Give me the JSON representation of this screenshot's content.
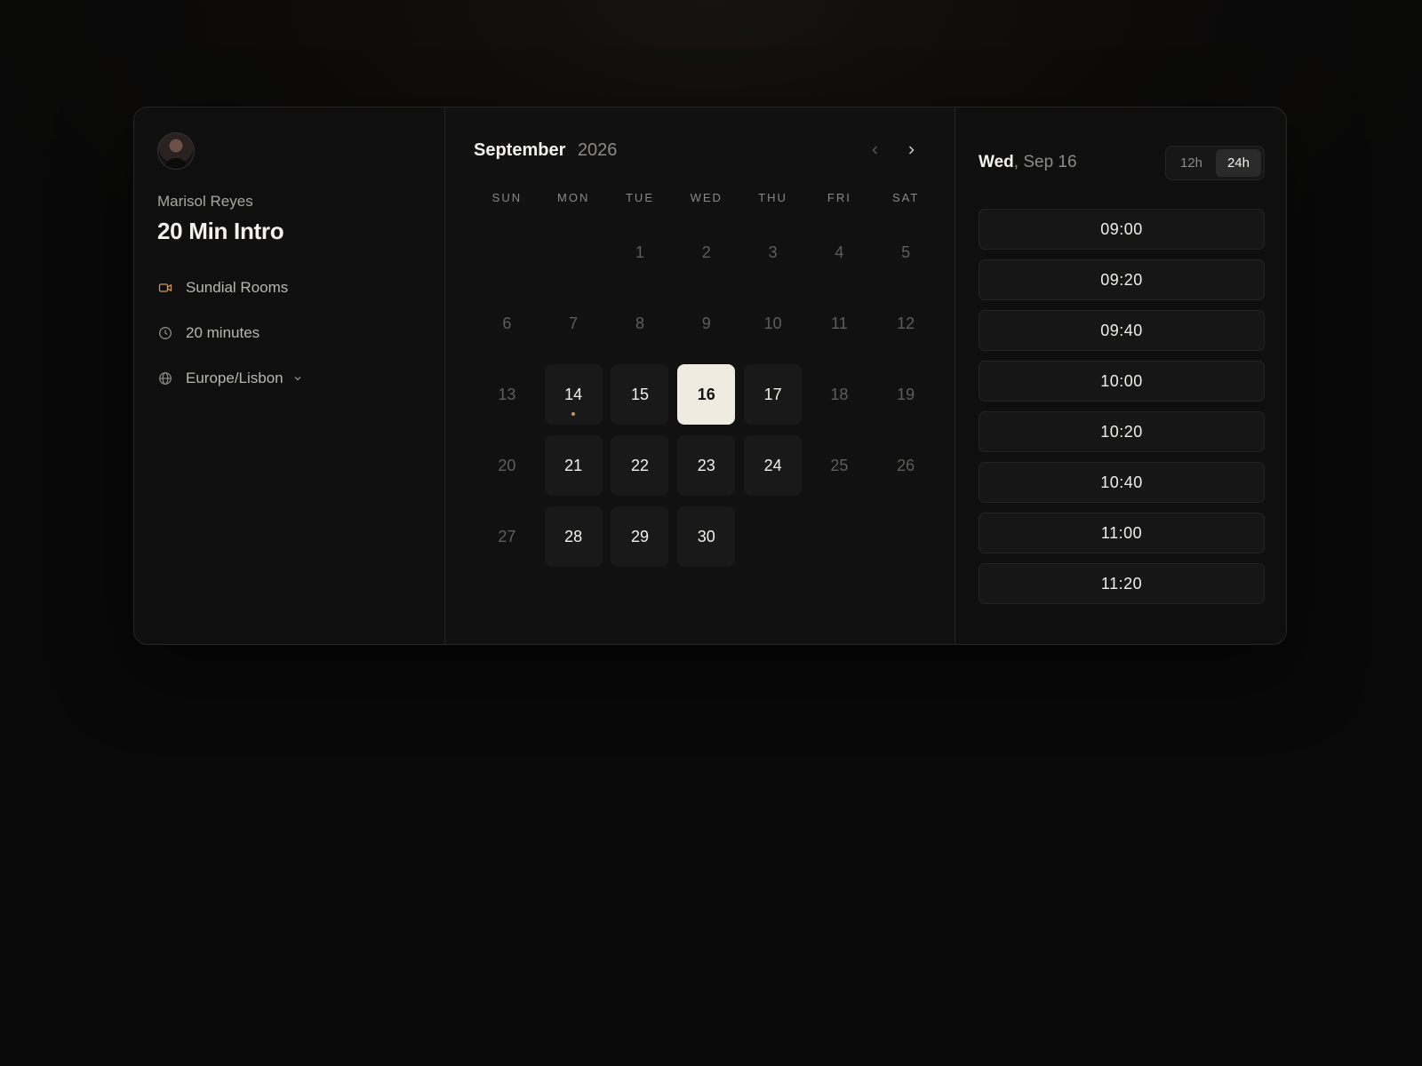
{
  "host": {
    "name": "Marisol Reyes",
    "event_title": "20 Min Intro"
  },
  "meta": {
    "location": "Sundial Rooms",
    "duration": "20 minutes",
    "timezone": "Europe/Lisbon",
    "location_icon": "video-camera-icon",
    "duration_icon": "clock-icon",
    "timezone_icon": "globe-icon"
  },
  "calendar": {
    "month": "September",
    "year": "2026",
    "weekdays": [
      "SUN",
      "MON",
      "TUE",
      "WED",
      "THU",
      "FRI",
      "SAT"
    ],
    "first_weekday_index": 2,
    "days_in_month": 30,
    "available_days": [
      14,
      15,
      16,
      17,
      21,
      22,
      23,
      24,
      28,
      29,
      30
    ],
    "selected_day": 16,
    "today_marker_day": 14
  },
  "slots_panel": {
    "day": "Wed",
    "date": "Sep 16",
    "format_options": [
      "12h",
      "24h"
    ],
    "active_format": "24h",
    "times": [
      "09:00",
      "09:20",
      "09:40",
      "10:00",
      "10:20",
      "10:40",
      "11:00",
      "11:20"
    ]
  },
  "colors": {
    "accent": "#c9955a",
    "selected_bg": "#efebe1"
  }
}
